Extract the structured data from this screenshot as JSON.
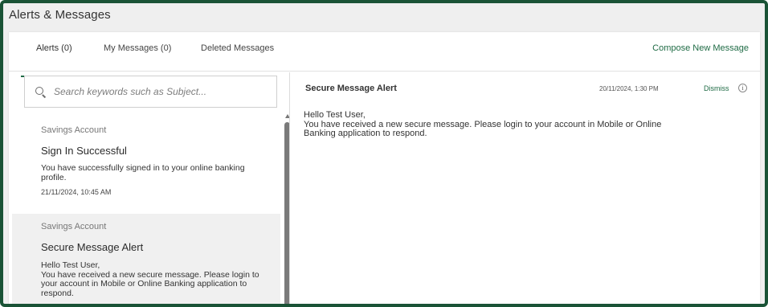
{
  "page": {
    "title": "Alerts & Messages"
  },
  "tabs": [
    {
      "label": "Alerts (0)",
      "active": true
    },
    {
      "label": "My Messages (0)",
      "active": false
    },
    {
      "label": "Deleted Messages",
      "active": false
    }
  ],
  "compose_label": "Compose New Message",
  "search": {
    "placeholder": "Search keywords such as Subject...",
    "icon": "search-icon"
  },
  "messages": [
    {
      "category": "Savings Account",
      "subject": "Sign In Successful",
      "body": "You have successfully signed in to your online banking profile.",
      "date": "21/11/2024, 10:45 AM"
    },
    {
      "category": "Savings Account",
      "subject": "Secure Message Alert",
      "body_greeting": "Hello Test User,",
      "body": "You have received a new secure message. Please login to your account in Mobile or Online Banking application to respond."
    }
  ],
  "detail": {
    "title": "Secure Message Alert",
    "date": "20/11/2024, 1:30 PM",
    "dismiss_label": "Dismiss",
    "info_icon": "info-icon",
    "greeting": "Hello Test User,",
    "body": "You have received a new secure message. Please login to your account in Mobile or Online Banking application to respond."
  },
  "colors": {
    "brand_green": "#1a5336",
    "accent_green": "#1f6b45"
  }
}
